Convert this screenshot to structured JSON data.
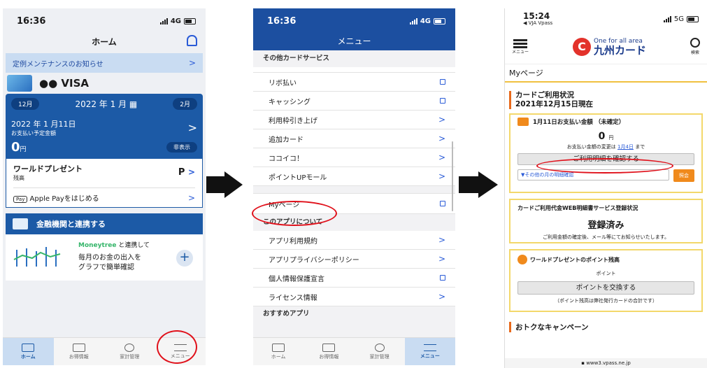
{
  "phone1": {
    "status_time": "16:36",
    "network": "4G",
    "title": "ホーム",
    "notice": "定例メンテナンスのお知らせ",
    "card_name": "●● VISA",
    "prev_month": "12月",
    "current_month": "2022 年 1 月",
    "next_month": "2月",
    "pay_date": "2022 年 1 月11日",
    "pay_label": "お支払い予定金額",
    "amount": "0",
    "amount_unit": "円",
    "hide_button": "非表示",
    "world_present": "ワールドプレゼント",
    "balance": "残高",
    "points_unit": "P",
    "apple_pay_badge": "Pay",
    "apple_pay": "Apple Payをはじめる",
    "fin_title": "金融機関と連携する",
    "moneytree": "Moneytree",
    "moneytree_suffix": " と連携して",
    "fin_desc1": "毎月のお金の出入を",
    "fin_desc2": "グラフで簡単確認",
    "tabs": [
      "ホーム",
      "お得情報",
      "家計管理",
      "メニュー"
    ]
  },
  "phone2": {
    "status_time": "16:36",
    "network": "4G",
    "title": "メニュー",
    "section1": "その他カードサービス",
    "section1_items": [
      "リボ払い",
      "キャッシング",
      "利用枠引き上げ",
      "追加カード",
      "ココイコ！",
      "ポイントUPモール"
    ],
    "mypage": "Myページ",
    "section2": "このアプリについて",
    "section2_items": [
      "アプリ利用規約",
      "アプリプライバシーポリシー",
      "個人情報保護宣言",
      "ライセンス情報"
    ],
    "section3": "おすすめアプリ",
    "tabs": [
      "ホーム",
      "お得情報",
      "家計管理",
      "メニュー"
    ]
  },
  "phone3": {
    "status_time": "15:24",
    "back_label": "◀ VJA Vpass",
    "network": "5G",
    "menu_label": "メニュー",
    "brand_sub": "One for all area",
    "brand_main": "九州カード",
    "search_label": "検索",
    "mypage": "Myページ",
    "usage_title": "カードご利用状況",
    "usage_date": "2021年12月15日現在",
    "pay_title": "1月11日お支払い金額 （未確定）",
    "pay_amount": "0",
    "pay_unit": "円",
    "change_prefix": "お支払い金額の変更は",
    "change_link": "1月4日",
    "change_suffix": "まで",
    "confirm_button": "ご利用明細を確認する",
    "other_month": "▼その他の月の明細確認",
    "inquiry_button": "照会",
    "web_title": "カードご利用代金WEB明細書サービス登録状況",
    "web_status": "登録済み",
    "web_note": "ご利用金額の確定後、メール等にてお知らせいたします。",
    "point_title": "ワールドプレゼントのポイント残高",
    "point_label": "ポイント",
    "exchange_button": "ポイントを交換する",
    "point_note": "（ポイント残高は弊社発行カードの合計です）",
    "campaign": "おトクなキャンペーン",
    "url": "www3.vpass.ne.jp"
  },
  "colors": {
    "accent": "#1c5aa6",
    "highlight": "#e0101a",
    "gold": "#f3d86b",
    "orange": "#f08a1c"
  }
}
